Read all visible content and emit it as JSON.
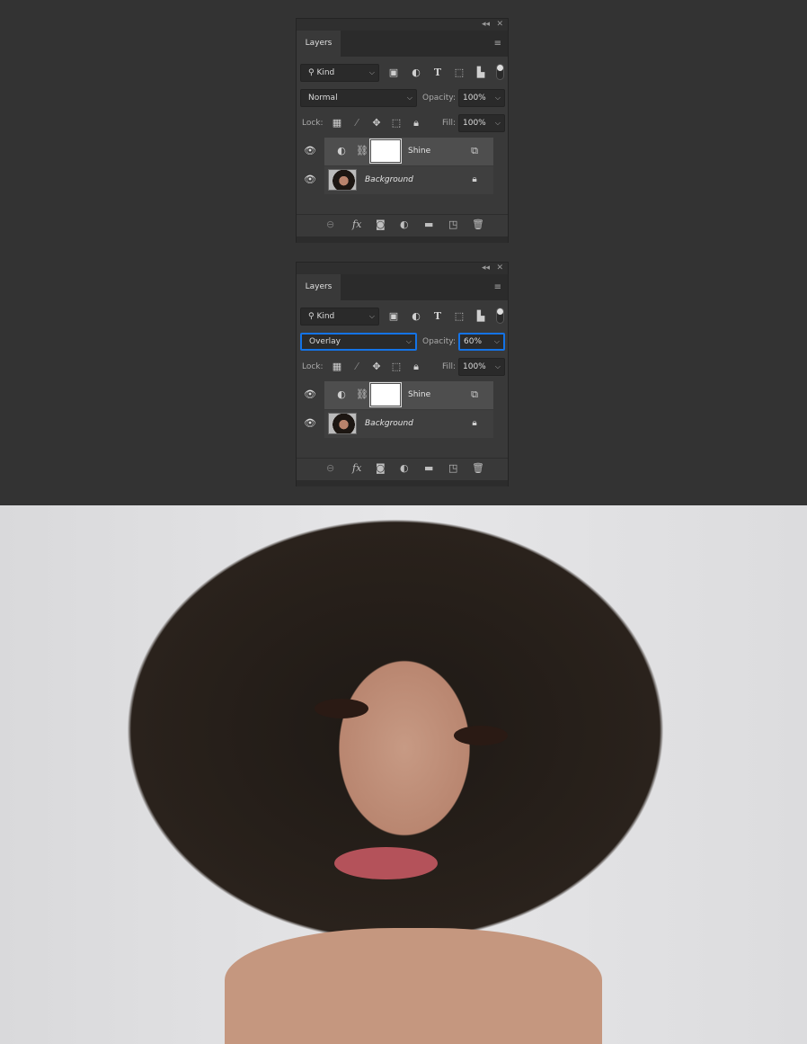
{
  "panels": [
    {
      "title": "Layers",
      "filter": "Kind",
      "blend_mode": "Normal",
      "opacity_label": "Opacity:",
      "opacity": "100%",
      "lock_label": "Lock:",
      "fill_label": "Fill:",
      "fill": "100%",
      "blend_focused": false,
      "layers": [
        {
          "name": "Shine",
          "type": "adjustment",
          "selected": true
        },
        {
          "name": "Background",
          "type": "image",
          "locked": true
        }
      ]
    },
    {
      "title": "Layers",
      "filter": "Kind",
      "blend_mode": "Overlay",
      "opacity_label": "Opacity:",
      "opacity": "60%",
      "lock_label": "Lock:",
      "fill_label": "Fill:",
      "fill": "100%",
      "blend_focused": true,
      "layers": [
        {
          "name": "Shine",
          "type": "adjustment",
          "selected": true
        },
        {
          "name": "Background",
          "type": "image",
          "locked": true
        }
      ]
    }
  ],
  "colors": {
    "focus": "#1473e6",
    "panel": "#393939"
  },
  "photo": {
    "description_icon": "portrait-photo"
  }
}
